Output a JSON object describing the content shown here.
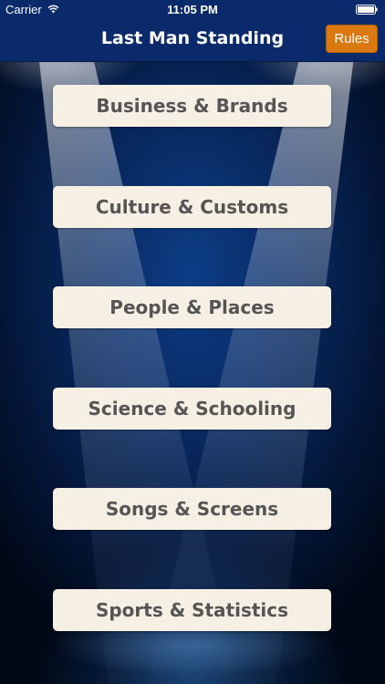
{
  "status_bar": {
    "carrier": "Carrier",
    "time": "11:05 PM",
    "wifi_icon": "wifi-icon",
    "battery_icon": "battery-icon"
  },
  "nav": {
    "title": "Last Man Standing",
    "rules_label": "Rules"
  },
  "categories": [
    {
      "label": "Business & Brands"
    },
    {
      "label": "Culture & Customs"
    },
    {
      "label": "People & Places"
    },
    {
      "label": "Science & Schooling"
    },
    {
      "label": "Songs & Screens"
    },
    {
      "label": "Sports & Statistics"
    }
  ],
  "colors": {
    "nav_background": "#0a2a6b",
    "rules_button": "#d9790f",
    "category_button": "#f5efe4",
    "category_text": "#555555"
  }
}
